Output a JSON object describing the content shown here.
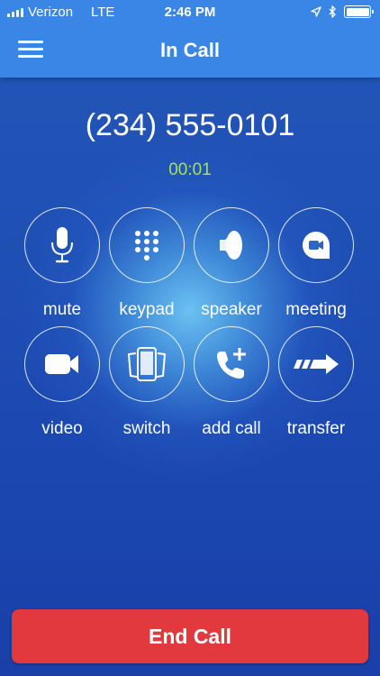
{
  "status_bar": {
    "carrier": "Verizon",
    "network": "LTE",
    "time": "2:46 PM"
  },
  "header": {
    "title": "In Call"
  },
  "call": {
    "number": "(234) 555-0101",
    "duration": "00:01"
  },
  "controls": {
    "mute": "mute",
    "keypad": "keypad",
    "speaker": "speaker",
    "meeting": "meeting",
    "video": "video",
    "switch": "switch",
    "add_call": "add call",
    "transfer": "transfer"
  },
  "end_call_label": "End Call",
  "colors": {
    "header": "#3a86e6",
    "background": "#1e4fb4",
    "timer": "#a6e05a",
    "end_call": "#e2393f"
  }
}
